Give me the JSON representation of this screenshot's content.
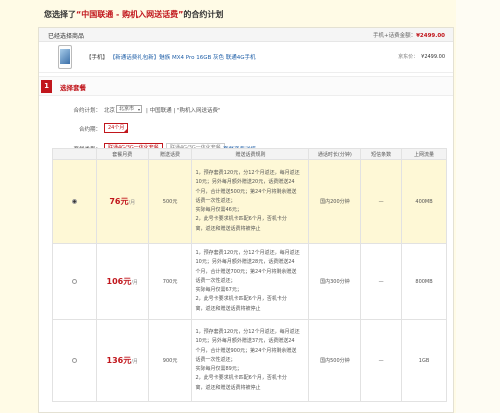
{
  "header": {
    "prefix": "您选择了",
    "plan_name": "“中国联通 - 购机入网送话费”",
    "suffix": "的合约计划"
  },
  "selected_products": {
    "title": "已经选择商品",
    "total_label": "手机+话费金额：",
    "total_amount": "¥2499.00"
  },
  "product": {
    "tag": "【手机】",
    "promo": "【新通话费礼包新】",
    "name": "魅族 MX4 Pro 16GB 灰色 联通4G手机",
    "jd_price_label": "京东价：",
    "jd_price": "¥2499.00"
  },
  "section": {
    "number": "1",
    "title": "选择套餐",
    "contract_label": "合约计划：",
    "province": "北京",
    "city": "北京市",
    "plan": "| 中国联通 | \"购机入网送话费\"",
    "period_label": "合约期：",
    "period_value": "24个月",
    "type_label": "套餐类型：",
    "type_selected": "联通4G/3G一体化套餐",
    "type_other": "联通4G/3G一体化套餐",
    "detail_link": "套餐资费详情"
  },
  "table": {
    "headers": [
      "",
      "套餐月费",
      "赠送话费",
      "赠送话费规则",
      "通话时长(分钟)",
      "短信条数",
      "上网流量"
    ],
    "rows": [
      {
        "selected": true,
        "price": "76元",
        "per": "/月",
        "gift": "500元",
        "rules": [
          "1，预存套费120元，分12个月返还，每月返还",
          "10元；另外每月额外赠送20元，话费赠送24",
          "个月，合计赠送500元；第24个月将剩余赠送",
          "话费一次性返还；",
          "实际每月仅需46元；",
          "2，此号卡要求机卡匹配6个月，否机卡分",
          "离，返还和赠送话费将被停止"
        ],
        "calls": "国内200分钟",
        "sms": "—",
        "data": "400MB"
      },
      {
        "selected": false,
        "price": "106元",
        "per": "/月",
        "gift": "700元",
        "rules": [
          "1，预存套费120元，分12个月返还，每月返还",
          "10元；另外每月额外赠送28元，话费赠送24",
          "个月，合计赠送700元；第24个月将剩余赠送",
          "话费一次性返还；",
          "实际每月仅需67元；",
          "2，此号卡要求机卡匹配6个月，否机卡分",
          "离，返还和赠送话费将被停止"
        ],
        "calls": "国内300分钟",
        "sms": "—",
        "data": "800MB"
      },
      {
        "selected": false,
        "price": "136元",
        "per": "/月",
        "gift": "900元",
        "rules": [
          "1，预存套费120元，分12个月返还，每月返还",
          "10元；另外每月额外赠送37元，话费赠送24",
          "个月，合计赠送900元；第24个月将剩余赠送",
          "话费一次性返还；",
          "实际每月仅需89元；",
          "2，此号卡要求机卡匹配6个月，否机卡分",
          "离，返还和赠送话费将被停止"
        ],
        "calls": "国内500分钟",
        "sms": "—",
        "data": "1GB"
      }
    ]
  },
  "colors": {
    "accent": "#c1161c",
    "link": "#1f5fa8",
    "selected_row": "#fef8d6"
  }
}
